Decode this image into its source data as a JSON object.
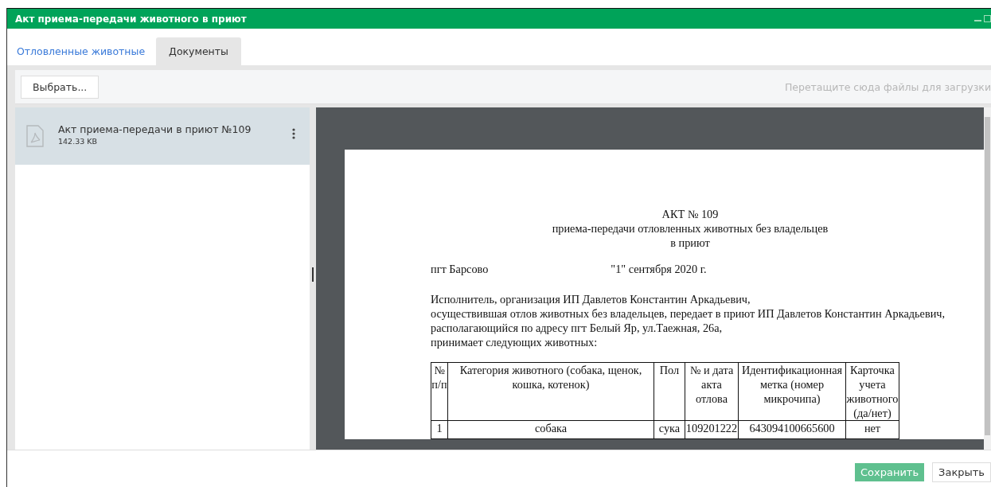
{
  "window": {
    "title": "Акт приема-передачи животного в приют"
  },
  "tabs": [
    {
      "label": "Отловленные животные",
      "selected": false
    },
    {
      "label": "Документы",
      "selected": true
    }
  ],
  "toolbar": {
    "choose_button": "Выбрать...",
    "drop_hint": "Перетащите сюда файлы для загрузки"
  },
  "files": [
    {
      "name": "Акт приема-передачи в приют №109",
      "size": "142.33 KB",
      "selected": true
    }
  ],
  "document": {
    "heading": [
      "АКТ № 109",
      "приема-передачи отловленных животных без владельцев",
      "в приют"
    ],
    "place": "пгт Барсово",
    "date": "\"1\" сентября 2020 г.",
    "paragraphs": [
      "Исполнитель, организация ИП Давлетов Константин Аркадьевич,",
      "осуществившая отлов животных без владельцев, передает в приют ИП Давлетов Константин Аркадьевич,",
      "располагающийся по адресу пгт Белый Яр, ул.Таежная, 26а,",
      "принимает следующих животных:"
    ],
    "table": {
      "columns": [
        "№ п/п",
        "Категория животного (собака, щенок, кошка, котенок)",
        "Пол",
        "№ и дата акта отлова",
        "Идентификационная метка (номер микрочипа)",
        "Карточка учета животного (да/нет)"
      ],
      "rows": [
        [
          "1",
          "собака",
          "сука",
          "109201222",
          "643094100665600",
          "нет"
        ]
      ]
    }
  },
  "buttons": [
    {
      "label": "Сохранить",
      "kind": "primary"
    },
    {
      "label": "Закрыть",
      "kind": "secondary"
    }
  ]
}
